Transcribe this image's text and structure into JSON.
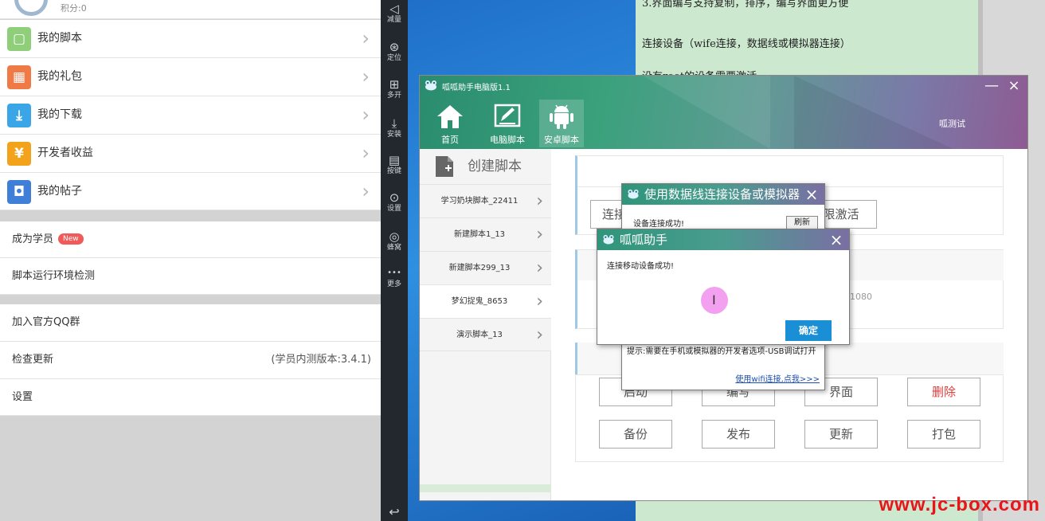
{
  "phone": {
    "score": "积分:0",
    "menu": [
      {
        "label": "我的脚本",
        "icon": "script-icon",
        "color": "#8fcf7a",
        "glyph": "▢"
      },
      {
        "label": "我的礼包",
        "icon": "gift-icon",
        "color": "#f07a45",
        "glyph": "▦"
      },
      {
        "label": "我的下载",
        "icon": "download-icon",
        "color": "#3aa6e8",
        "glyph": "⤓"
      },
      {
        "label": "开发者收益",
        "icon": "yen-icon",
        "color": "#f3a21b",
        "glyph": "¥"
      },
      {
        "label": "我的帖子",
        "icon": "post-icon",
        "color": "#3f7fd8",
        "glyph": "◘"
      }
    ],
    "become_student": "成为学员",
    "new_badge": "New",
    "env_check": "脚本运行环境检测",
    "join_qq": "加入官方QQ群",
    "check_update": "检查更新",
    "version": "(学员内测版本:3.4.1)",
    "settings": "设置"
  },
  "sidebar": {
    "items": [
      {
        "label": "减量",
        "icon": "volume-down-icon",
        "glyph": "◁"
      },
      {
        "label": "定位",
        "icon": "location-icon",
        "glyph": "⊛"
      },
      {
        "label": "多开",
        "icon": "multi-open-icon",
        "glyph": "⊞"
      },
      {
        "label": "安装",
        "icon": "apk-install-icon",
        "glyph": "⤓"
      },
      {
        "label": "按键",
        "icon": "keyboard-icon",
        "glyph": "▤"
      },
      {
        "label": "设置",
        "icon": "settings-icon",
        "glyph": "⊙"
      },
      {
        "label": "蜂窝",
        "icon": "cellular-icon",
        "glyph": "◎"
      },
      {
        "label": "更多",
        "icon": "more-icon",
        "glyph": "•••"
      }
    ]
  },
  "notes": {
    "line1": "3.界面编写支持复制，排序，编写界面更方便",
    "line2": "连接设备（wife连接，数据线或模拟器连接）",
    "line3": "没有root的设备需要激活"
  },
  "app": {
    "title": "呱呱助手电脑版1.1",
    "minimize": "—",
    "close": "×",
    "tabs": [
      {
        "label": "首页",
        "icon": "home-icon"
      },
      {
        "label": "电脑脚本",
        "icon": "pc-script-icon"
      },
      {
        "label": "安卓脚本",
        "icon": "android-icon"
      }
    ],
    "user": "呱测试",
    "create_script": "创建脚本",
    "scripts": [
      "学习奶块脚本_22411",
      "新建脚本1_13",
      "新建脚本299_13",
      "梦幻捉鬼_8653",
      "演示脚本_13"
    ],
    "connect_btn": "连接",
    "activate_btn": "限激活",
    "info_suffix": "1080",
    "buttons_row1": [
      "启动",
      "编写",
      "界面",
      "删除"
    ],
    "buttons_row2": [
      "备份",
      "发布",
      "更新",
      "打包"
    ],
    "colors": {
      "danger": "#e03c3c"
    }
  },
  "dialog_connect": {
    "title": "使用数据线连接设备或模拟器",
    "close": "×",
    "status": "设备连接成功!",
    "refresh": "刷新",
    "hint": "提示:需要在手机或模拟器的开发者选项-USB调试打开",
    "wifi_link": "使用wifi连接,点我>>>"
  },
  "dialog_success": {
    "title": "呱呱助手",
    "close": "×",
    "message": "连接移动设备成功!",
    "ok": "确定"
  },
  "watermark": "www.jc-box.com"
}
